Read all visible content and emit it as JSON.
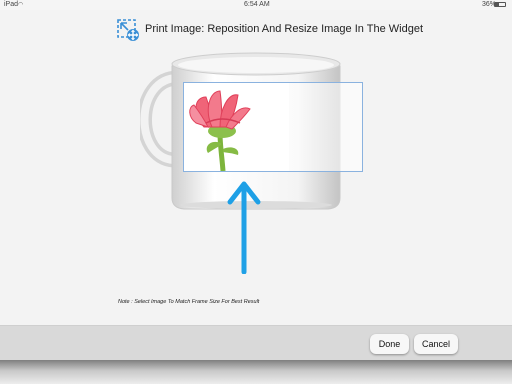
{
  "status_bar": {
    "carrier": "iPad",
    "time": "6:54 AM",
    "battery_percent": "36%",
    "battery_level": 0.36,
    "wifi_icon": "wifi-icon",
    "battery_icon": "battery-icon"
  },
  "header": {
    "title": "Print Image: Reposition And Resize Image In The Widget",
    "icon": "resize-move-icon",
    "accent_color": "#3a8fd6"
  },
  "canvas": {
    "product": "white coffee mug",
    "photo_subject": "pink flower illustration",
    "frame_color": "#8ab2df",
    "arrow_color": "#1ea0e6"
  },
  "note": "Note : Select Image To Match Frame Size For Best Result",
  "footer": {
    "done_label": "Done",
    "cancel_label": "Cancel"
  }
}
